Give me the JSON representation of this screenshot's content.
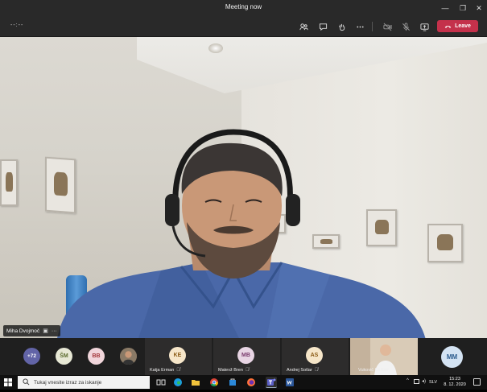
{
  "window": {
    "title": "Meeting now",
    "minimize_glyph": "—",
    "maximize_glyph": "❐",
    "close_glyph": "✕"
  },
  "toolbar": {
    "timer": "--:--",
    "leave_label": "Leave",
    "icons": [
      "participants-icon",
      "chat-icon",
      "raise-hand-icon",
      "more-actions-icon",
      "camera-off-icon",
      "mic-off-icon",
      "share-screen-icon"
    ]
  },
  "main_video": {
    "speaker_name": "Miha Dvojmoč",
    "more_glyph": "···"
  },
  "strip": {
    "overflow_count": "+72",
    "avatars": [
      {
        "initials": "ŠM",
        "color": "#e7e8d5",
        "text": "#5b6b2e"
      },
      {
        "initials": "BB",
        "color": "#f1d6db",
        "text": "#a4373a"
      }
    ],
    "tiles": [
      {
        "initials": "KE",
        "name": "Katja Erman",
        "color": "#f6e6c9",
        "text": "#8a5a14"
      },
      {
        "initials": "MB",
        "name": "Matevž Bren",
        "color": "#e8d5e4",
        "text": "#7a3b6e"
      },
      {
        "initials": "AS",
        "name": "Andrej Sotlar",
        "color": "#f6e6c9",
        "text": "#8a5a14"
      }
    ],
    "video_tile_name": "Vukovič Dalibor",
    "last_avatar": {
      "initials": "MM",
      "color": "#d4e3f3",
      "text": "#2b5a8c"
    }
  },
  "taskbar": {
    "search_placeholder": "Tukaj vnesite izraz za iskanje",
    "language": "SLV",
    "time": "15:23",
    "date": "8. 12. 2020"
  }
}
